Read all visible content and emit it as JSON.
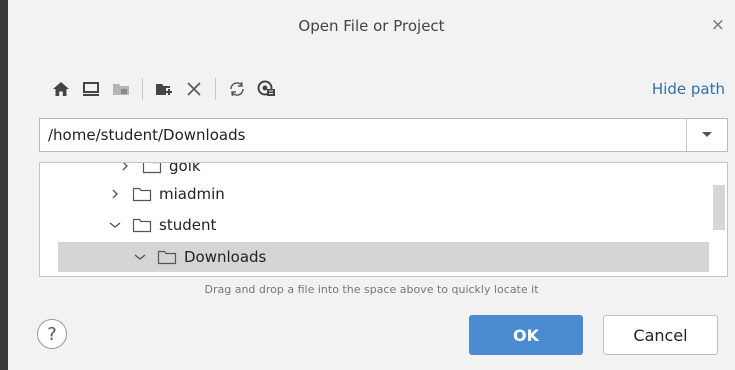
{
  "dialog": {
    "title": "Open File or Project",
    "close_label": "×"
  },
  "toolbar": {
    "buttons": [
      {
        "name": "home-icon"
      },
      {
        "name": "desktop-icon"
      },
      {
        "name": "project-folder-icon"
      },
      {
        "name": "new-folder-icon"
      },
      {
        "name": "delete-icon"
      },
      {
        "name": "refresh-icon"
      },
      {
        "name": "show-hidden-icon"
      }
    ],
    "hide_path_label": "Hide path"
  },
  "path": {
    "value": "/home/student/Downloads"
  },
  "tree": {
    "items": [
      {
        "label": "goik",
        "expanded": false,
        "depth": 1
      },
      {
        "label": "miadmin",
        "expanded": false,
        "depth": 1
      },
      {
        "label": "student",
        "expanded": true,
        "depth": 1
      },
      {
        "label": "Downloads",
        "expanded": true,
        "depth": 2,
        "selected": true
      }
    ]
  },
  "hint": "Drag and drop a file into the space above to quickly locate it",
  "buttons": {
    "help_label": "?",
    "ok_label": "OK",
    "cancel_label": "Cancel"
  },
  "colors": {
    "accent": "#4a8ad0",
    "link": "#2f6fb5",
    "selection": "#d5d5d5"
  }
}
